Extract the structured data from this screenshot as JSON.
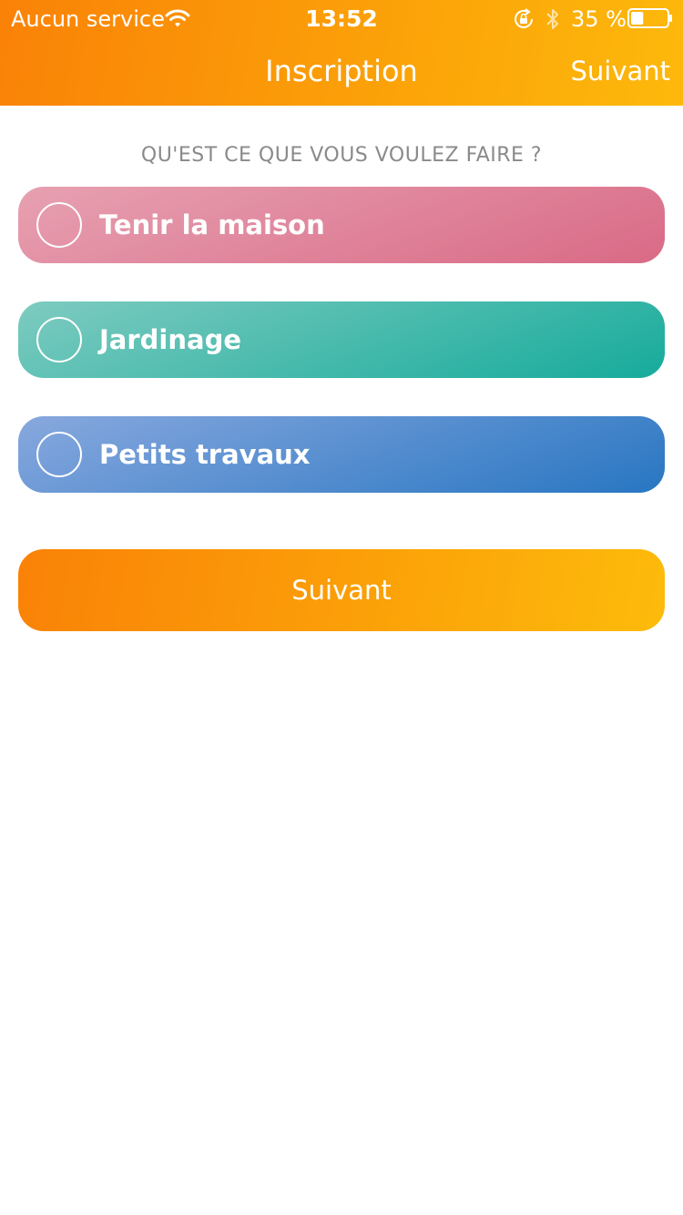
{
  "status_bar": {
    "carrier": "Aucun service",
    "time": "13:52",
    "battery_percent": "35 %",
    "battery_level": 0.35,
    "icons": [
      "wifi-icon",
      "orientation-lock-icon",
      "bluetooth-icon",
      "battery-icon"
    ]
  },
  "nav": {
    "title": "Inscription",
    "next_label": "Suivant"
  },
  "question": "QU'EST CE QUE VOUS VOULEZ FAIRE ?",
  "options": [
    {
      "label": "Tenir la maison",
      "selected": false,
      "color_start": "#e7a1b1",
      "color_end": "#d96a86"
    },
    {
      "label": "Jardinage",
      "selected": false,
      "color_start": "#7ecbc0",
      "color_end": "#16ab9b"
    },
    {
      "label": "Petits travaux",
      "selected": false,
      "color_start": "#88a8de",
      "color_end": "#2876c2"
    }
  ],
  "next_button": {
    "label": "Suivant"
  },
  "colors": {
    "accent_start": "#fa8207",
    "accent_end": "#fdb90b",
    "question_text": "#8a8a8a",
    "background": "#ffffff"
  }
}
